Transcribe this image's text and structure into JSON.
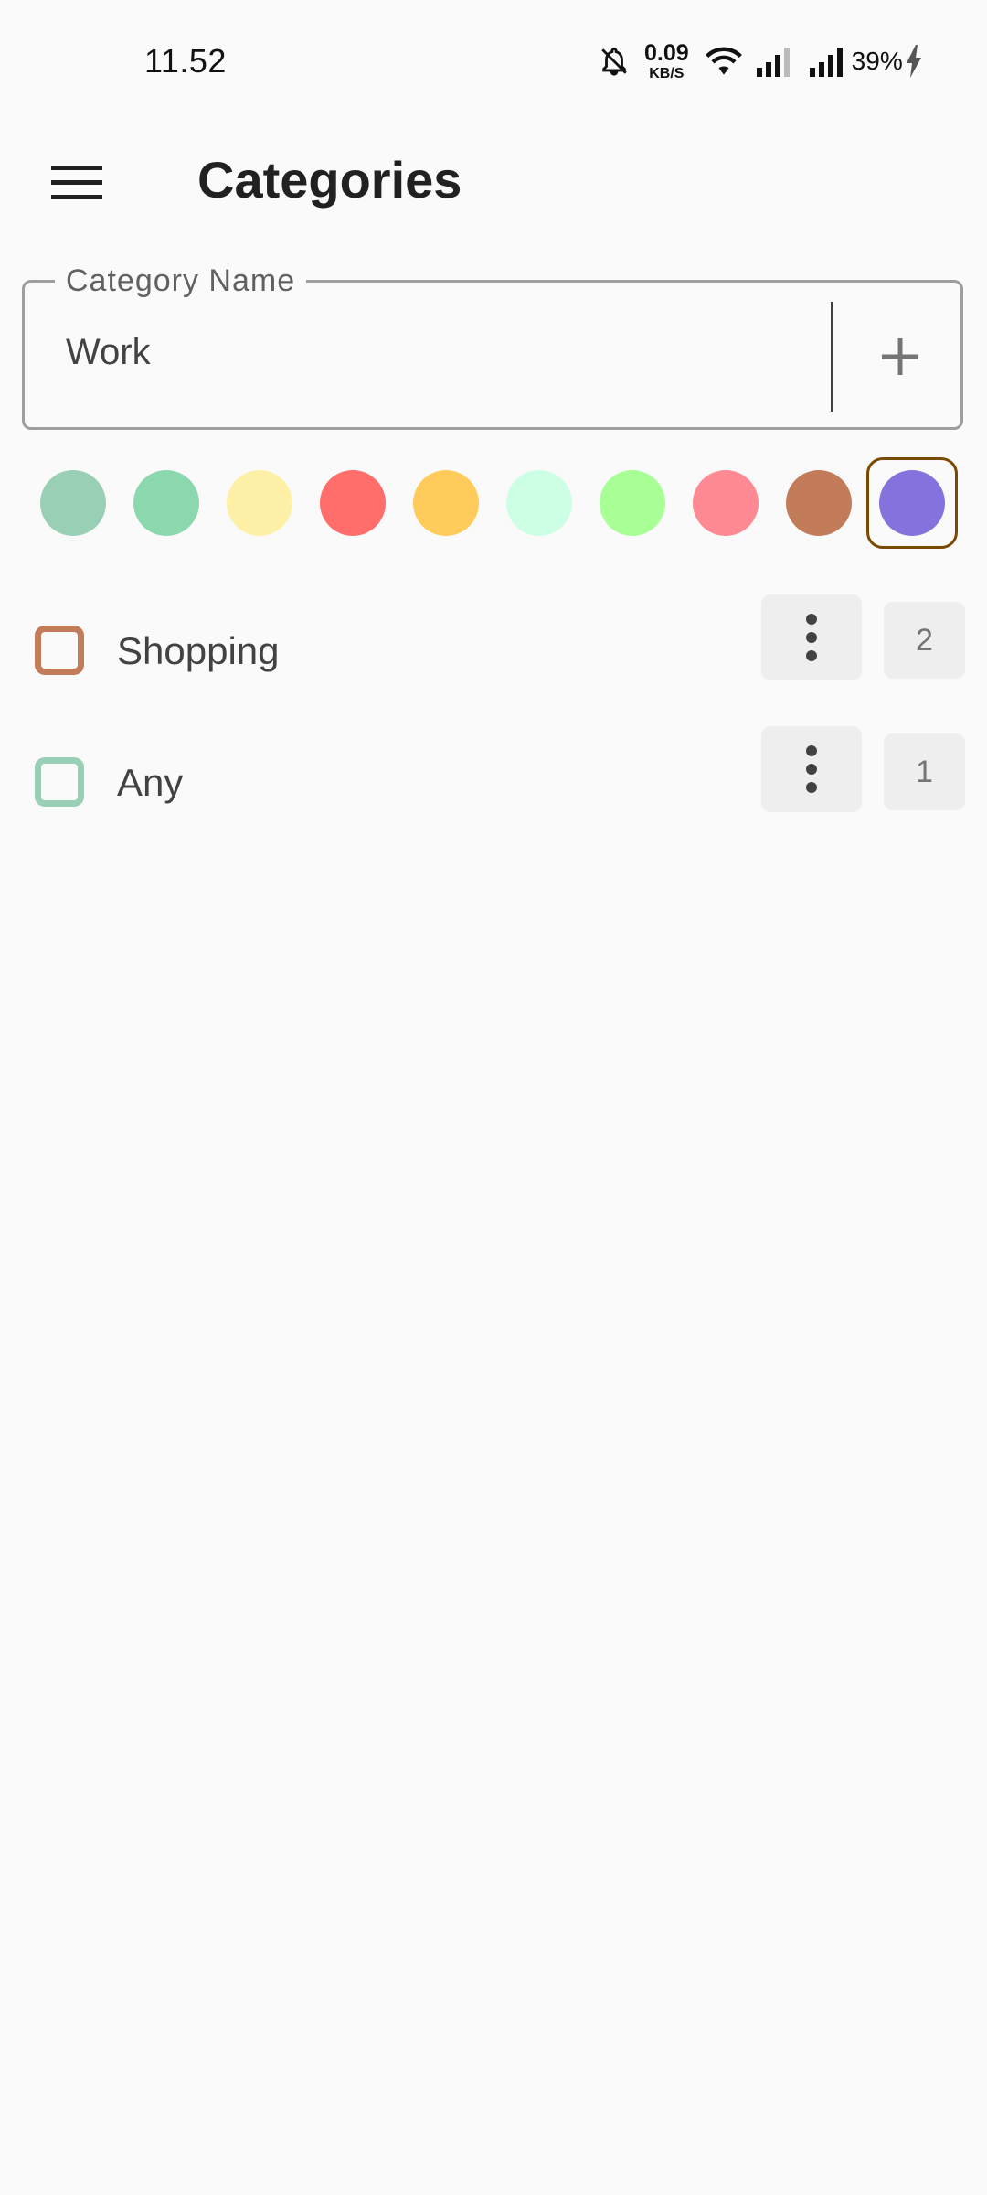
{
  "status_bar": {
    "time": "11.52",
    "net_speed_value": "0.09",
    "net_speed_unit": "KB/S",
    "battery_percent": "39%"
  },
  "app_bar": {
    "title": "Categories"
  },
  "category_form": {
    "label": "Category Name",
    "value": "Work",
    "add_icon": "plus-icon"
  },
  "palette": {
    "colors": [
      "#99cfb4",
      "#8cd8ae",
      "#fff0a8",
      "#ff6e6a",
      "#ffcc5c",
      "#ccffe3",
      "#a8ff96",
      "#ff8a94",
      "#c27c5a",
      "#8672dc"
    ],
    "selected_index": 9,
    "selected_border_color": "#7a4a00"
  },
  "categories": [
    {
      "name": "Shopping",
      "color": "#c27c5a",
      "count": "2",
      "checked": false
    },
    {
      "name": "Any",
      "color": "#99cfb4",
      "count": "1",
      "checked": false
    }
  ]
}
